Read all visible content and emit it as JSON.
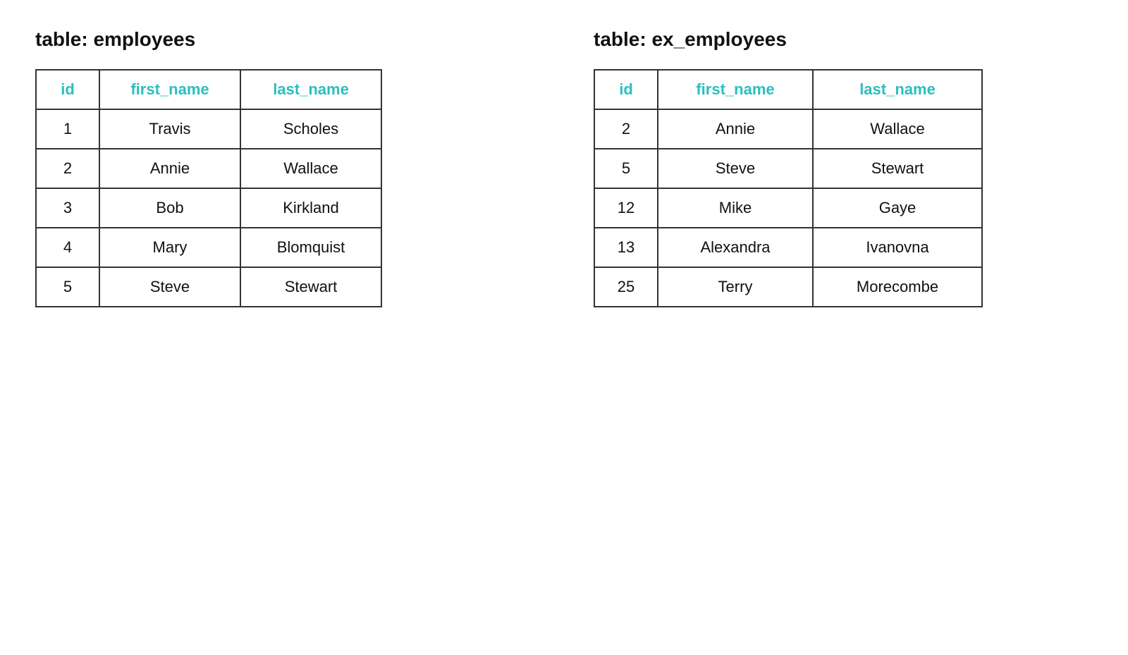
{
  "employees_table": {
    "title": "table: employees",
    "columns": [
      "id",
      "first_name",
      "last_name"
    ],
    "rows": [
      {
        "id": "1",
        "first_name": "Travis",
        "last_name": "Scholes"
      },
      {
        "id": "2",
        "first_name": "Annie",
        "last_name": "Wallace"
      },
      {
        "id": "3",
        "first_name": "Bob",
        "last_name": "Kirkland"
      },
      {
        "id": "4",
        "first_name": "Mary",
        "last_name": "Blomquist"
      },
      {
        "id": "5",
        "first_name": "Steve",
        "last_name": "Stewart"
      }
    ]
  },
  "ex_employees_table": {
    "title": "table: ex_employees",
    "columns": [
      "id",
      "first_name",
      "last_name"
    ],
    "rows": [
      {
        "id": "2",
        "first_name": "Annie",
        "last_name": "Wallace"
      },
      {
        "id": "5",
        "first_name": "Steve",
        "last_name": "Stewart"
      },
      {
        "id": "12",
        "first_name": "Mike",
        "last_name": "Gaye"
      },
      {
        "id": "13",
        "first_name": "Alexandra",
        "last_name": "Ivanovna"
      },
      {
        "id": "25",
        "first_name": "Terry",
        "last_name": "Morecombe"
      }
    ]
  }
}
